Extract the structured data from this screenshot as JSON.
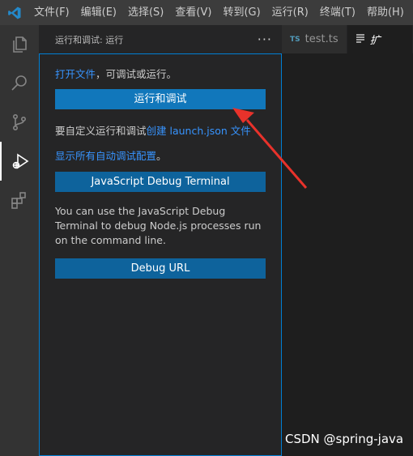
{
  "menubar": {
    "items": [
      "文件(F)",
      "编辑(E)",
      "选择(S)",
      "查看(V)",
      "转到(G)",
      "运行(R)",
      "终端(T)",
      "帮助(H)"
    ]
  },
  "sidebar": {
    "title": "运行和调试: 运行",
    "more": "···",
    "open_file_link": "打开文件",
    "open_file_suffix": "，可调试或运行。",
    "run_debug_button": "运行和调试",
    "customize_prefix": "要自定义运行和调试",
    "customize_link": "创建 launch.json 文件",
    "show_all_link": "显示所有自动调试配置",
    "show_all_suffix": "。",
    "js_terminal_button": "JavaScript Debug Terminal",
    "js_terminal_desc": "You can use the JavaScript Debug Terminal to debug Node.js processes run on the command line.",
    "debug_url_button": "Debug URL"
  },
  "tabs": [
    {
      "icon": "TS",
      "label": "test.ts"
    },
    {
      "icon": "lines-icon",
      "label": "扩"
    }
  ],
  "watermark": "CSDN @spring-java",
  "colors": {
    "accent": "#007fd4",
    "button": "#0e639c",
    "link": "#3794ff",
    "arrow": "#e8322b"
  }
}
